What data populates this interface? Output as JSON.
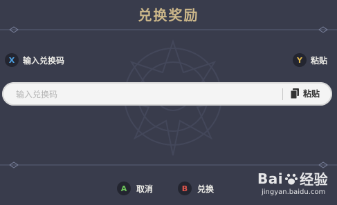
{
  "dialog": {
    "title": "兑换奖励",
    "colors": {
      "background": "#393c4c",
      "title": "#cdb88a",
      "input_bg": "#f4f4f4"
    }
  },
  "hint_bar": {
    "left": {
      "button": "X",
      "label": "输入兑换码",
      "icon": "gamepad-x-icon"
    },
    "right": {
      "button": "Y",
      "label": "粘贴",
      "icon": "gamepad-y-icon"
    }
  },
  "code_input": {
    "value": "",
    "placeholder": "输入兑换码",
    "paste_label": "粘贴",
    "paste_icon": "clipboard-icon"
  },
  "footer": {
    "cancel": {
      "button": "A",
      "label": "取消",
      "icon": "gamepad-a-icon"
    },
    "redeem": {
      "button": "B",
      "label": "兑换",
      "icon": "gamepad-b-icon"
    }
  },
  "watermark": {
    "brand_left": "Bai",
    "brand_right": "经验",
    "url": "jingyan.baidu.com",
    "icon": "baidu-paw-icon"
  }
}
